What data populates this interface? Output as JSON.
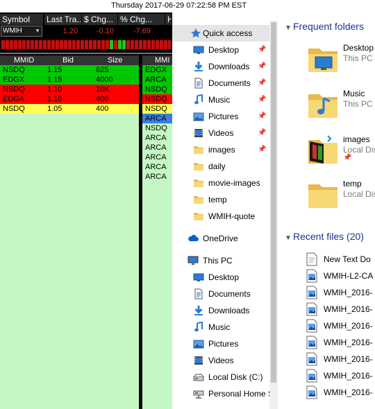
{
  "window_title": "Thursday 2017-06-29 07:22:58 PM EST",
  "quote_header": {
    "columns": [
      "Symbol",
      "Last Tra...",
      "$ Chg...",
      "% Chg...",
      "H"
    ],
    "symbol_value": "WMIH",
    "last": "1.20",
    "chg": "-0.10",
    "pct_chg": "-7.69"
  },
  "level2_left": {
    "headers": [
      "MMID",
      "Bid",
      "Size"
    ],
    "rows": [
      {
        "mmid": "NSDQ",
        "bid": "1.15",
        "size": "625",
        "color": "#00c800"
      },
      {
        "mmid": "EDGX",
        "bid": "1.15",
        "size": "4000",
        "color": "#00c800"
      },
      {
        "mmid": "NSDQ",
        "bid": "1.10",
        "size": "10K",
        "color": "#ff0000"
      },
      {
        "mmid": "EDGA",
        "bid": "1.10",
        "size": "400",
        "color": "#ff0000"
      },
      {
        "mmid": "NSDQ",
        "bid": "1.05",
        "size": "400",
        "color": "#ffff55"
      }
    ]
  },
  "level2_right": {
    "header": "MMI",
    "rows": [
      {
        "mmid": "EDGX",
        "color": "#00c800"
      },
      {
        "mmid": "ARCA",
        "color": "#00c800"
      },
      {
        "mmid": "NSDQ",
        "color": "#00c800"
      },
      {
        "mmid": "NSDQ",
        "color": "#ff0000"
      },
      {
        "mmid": "NSDQ",
        "color": "#ffff55"
      },
      {
        "mmid": "ARCA",
        "color": "#3a7ee0"
      },
      {
        "mmid": "NSDQ",
        "color": "#c4f7c4"
      },
      {
        "mmid": "ARCA",
        "color": "#c4f7c4"
      },
      {
        "mmid": "ARCA",
        "color": "#c4f7c4"
      },
      {
        "mmid": "ARCA",
        "color": "#c4f7c4"
      },
      {
        "mmid": "ARCA",
        "color": "#c4f7c4"
      },
      {
        "mmid": "ARCA",
        "color": "#c4f7c4"
      }
    ]
  },
  "nav": {
    "quick_access": "Quick access",
    "quick_items": [
      {
        "label": "Desktop",
        "icon": "desktop-icon",
        "pinned": true
      },
      {
        "label": "Downloads",
        "icon": "downloads-icon",
        "pinned": true
      },
      {
        "label": "Documents",
        "icon": "documents-icon",
        "pinned": true
      },
      {
        "label": "Music",
        "icon": "music-icon",
        "pinned": true
      },
      {
        "label": "Pictures",
        "icon": "pictures-icon",
        "pinned": true
      },
      {
        "label": "Videos",
        "icon": "videos-icon",
        "pinned": true
      },
      {
        "label": "images",
        "icon": "folder-icon",
        "pinned": true
      },
      {
        "label": "daily",
        "icon": "folder-icon",
        "pinned": false
      },
      {
        "label": "movie-images",
        "icon": "folder-icon",
        "pinned": false
      },
      {
        "label": "temp",
        "icon": "folder-icon",
        "pinned": false
      },
      {
        "label": "WMIH-quote",
        "icon": "folder-icon",
        "pinned": false
      }
    ],
    "onedrive": "OneDrive",
    "this_pc": "This PC",
    "pc_items": [
      {
        "label": "Desktop",
        "icon": "desktop-icon"
      },
      {
        "label": "Documents",
        "icon": "documents-icon"
      },
      {
        "label": "Downloads",
        "icon": "downloads-icon"
      },
      {
        "label": "Music",
        "icon": "music-icon"
      },
      {
        "label": "Pictures",
        "icon": "pictures-icon"
      },
      {
        "label": "Videos",
        "icon": "videos-icon"
      },
      {
        "label": "Local Disk (C:)",
        "icon": "disk-icon"
      },
      {
        "label": "Personal Home S",
        "icon": "network-drive-icon"
      }
    ]
  },
  "content": {
    "frequent_title": "Frequent folders",
    "frequent": [
      {
        "name": "Desktop",
        "location": "This PC",
        "kind": "desktop",
        "pinned": false
      },
      {
        "name": "Music",
        "location": "This PC",
        "kind": "music",
        "pinned": false
      },
      {
        "name": "images",
        "location": "Local Dis",
        "kind": "images",
        "pinned": true
      },
      {
        "name": "temp",
        "location": "Local Dis",
        "kind": "plain",
        "pinned": false
      }
    ],
    "recent_title": "Recent files (20)",
    "recent": [
      {
        "name": "New Text Do",
        "icon": "text-file-icon"
      },
      {
        "name": "WMIH-L2-CA",
        "icon": "image-file-icon"
      },
      {
        "name": "WMIH_2016-",
        "icon": "image-file-icon"
      },
      {
        "name": "WMIH_2016-",
        "icon": "image-file-icon"
      },
      {
        "name": "WMIH_2016-",
        "icon": "image-file-icon"
      },
      {
        "name": "WMIH_2016-",
        "icon": "image-file-icon"
      },
      {
        "name": "WMIH_2016-",
        "icon": "image-file-icon"
      },
      {
        "name": "WMIH_2016-",
        "icon": "image-file-icon"
      },
      {
        "name": "WMIH_2016-",
        "icon": "image-file-icon"
      }
    ]
  }
}
